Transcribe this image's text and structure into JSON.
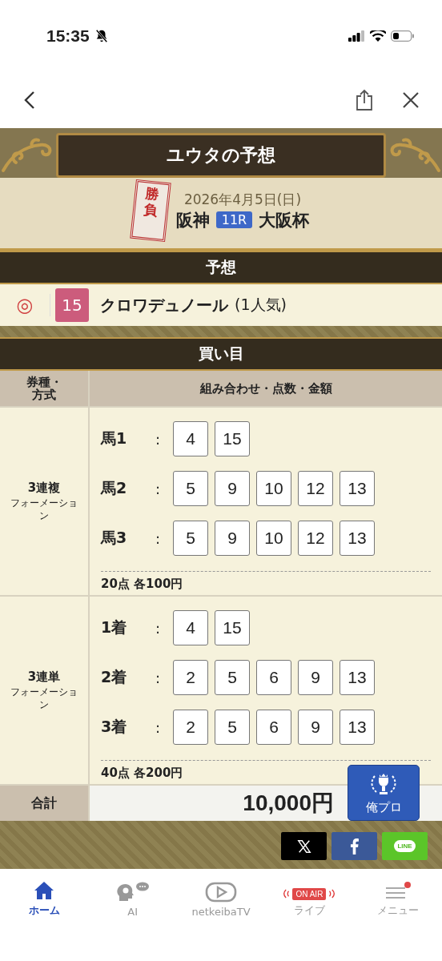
{
  "status_bar": {
    "time": "15:35"
  },
  "header": {
    "title": "ユウタの予想",
    "stamp": "勝負",
    "date": "2026年4月5日(日)",
    "venue": "阪神",
    "race_no": "11R",
    "race_name": "大阪杯"
  },
  "prediction": {
    "heading": "予想",
    "mark": "◎",
    "horse_no": "15",
    "horse_name": "クロワデュノール",
    "popularity": "(1人気)"
  },
  "bets": {
    "heading": "買い目",
    "columns": [
      "券種・方式",
      "組み合わせ・点数・金額"
    ],
    "groups": [
      {
        "type": "3連複",
        "method": "フォーメーション",
        "rows": [
          {
            "label": "馬1",
            "colon": ":",
            "numbers": [
              "4",
              "15"
            ]
          },
          {
            "label": "馬2",
            "colon": ":",
            "numbers": [
              "5",
              "9",
              "10",
              "12",
              "13"
            ]
          },
          {
            "label": "馬3",
            "colon": ":",
            "numbers": [
              "5",
              "9",
              "10",
              "12",
              "13"
            ]
          }
        ],
        "summary": "20点 各100円"
      },
      {
        "type": "3連単",
        "method": "フォーメーション",
        "rows": [
          {
            "label": "1着",
            "colon": ":",
            "numbers": [
              "4",
              "15"
            ]
          },
          {
            "label": "2着",
            "colon": ":",
            "numbers": [
              "2",
              "5",
              "6",
              "9",
              "13"
            ]
          },
          {
            "label": "3着",
            "colon": ":",
            "numbers": [
              "2",
              "5",
              "6",
              "9",
              "13"
            ]
          }
        ],
        "summary": "40点 各200円"
      }
    ],
    "total_label": "合計",
    "total": "10,000円"
  },
  "floating_button": {
    "label": "俺プロ"
  },
  "share": [
    {
      "kind": "x"
    },
    {
      "kind": "facebook"
    },
    {
      "kind": "line",
      "label": "LINE"
    }
  ],
  "tab_bar": [
    {
      "kind": "home",
      "label": "ホーム",
      "selected": true
    },
    {
      "kind": "ai",
      "label": "AI",
      "selected": false
    },
    {
      "kind": "tv",
      "label": "netkeibaTV",
      "selected": false
    },
    {
      "kind": "live",
      "label": "ライブ",
      "badge": "ON AIR",
      "selected": false
    },
    {
      "kind": "menu",
      "label": "メニュー",
      "selected": false
    }
  ]
}
